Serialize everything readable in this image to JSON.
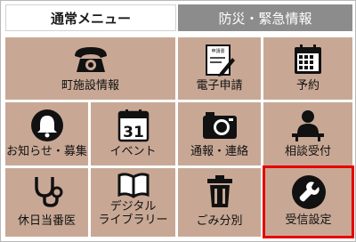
{
  "tabs": {
    "normal": "通常メニュー",
    "disaster": "防災・緊急情報"
  },
  "menu": {
    "facility": "町施設情報",
    "e_application": "電子申請",
    "e_application_doc_text": "申請書",
    "reservation": "予約",
    "notices": "お知らせ・募集",
    "event": "イベント",
    "event_calendar_day": "31",
    "report": "通報・連絡",
    "consultation": "相談受付",
    "holiday_doctor": "休日当番医",
    "digital_library_line1": "デジタル",
    "digital_library_line2": "ライブラリー",
    "garbage": "ごみ分別",
    "receive_settings": "受信設定"
  },
  "colors": {
    "tile": "#c8a895",
    "selected_outline": "#e60000",
    "inactive_tab": "#8c8c8c"
  }
}
